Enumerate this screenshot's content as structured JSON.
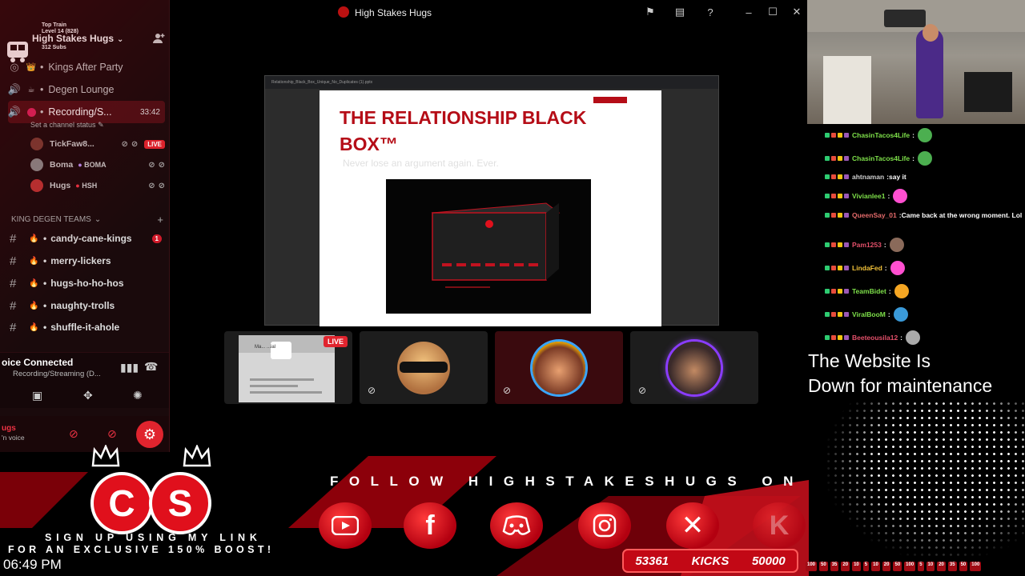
{
  "window": {
    "title": "High Stakes Hugs"
  },
  "sidebar": {
    "server_name": "High Stakes Hugs",
    "train": {
      "title": "Top Train",
      "level": "Level 14  (828)",
      "subs": "312 Subs"
    },
    "channels": [
      {
        "name": "Kings After Party"
      },
      {
        "name": "Degen Lounge"
      },
      {
        "name": "Recording/S...",
        "time": "33:42",
        "status": "Set a channel status"
      }
    ],
    "voice_users": [
      {
        "name": "TickFaw8...",
        "badge": "LIVE"
      },
      {
        "name": "Boma",
        "tag": "BOMA"
      },
      {
        "name": "Hugs",
        "tag": "HSH"
      }
    ],
    "category": "KING DEGEN TEAMS",
    "text_channels": [
      {
        "name": "candy-cane-kings",
        "count": "1"
      },
      {
        "name": "merry-lickers"
      },
      {
        "name": "hugs-ho-ho-hos"
      },
      {
        "name": "naughty-trolls"
      },
      {
        "name": "shuffle-it-ahole"
      }
    ],
    "voice_panel": {
      "title": "oice Connected",
      "subtitle": "Recording/Streaming (D..."
    },
    "user_panel": {
      "name": "ugs",
      "status": "'n voice"
    }
  },
  "screen": {
    "browser_tab": "Relationship_Black_Box_Unique_No_Duplicates (1).pptx",
    "slide": {
      "title": "THE RELATIONSHIP BLACK BOX™",
      "subtitle": "Never lose an argument again. Ever."
    },
    "tiles": [
      {
        "live": "LIVE",
        "preview_label": "Ma... ...ial"
      },
      {},
      {},
      {}
    ]
  },
  "chat": {
    "messages": [
      {
        "user": "ChasinTacos4Life",
        "text": "",
        "color": "#7ee04a"
      },
      {
        "user": "ChasinTacos4Life",
        "text": "",
        "color": "#7ee04a"
      },
      {
        "user": "ahtnaman",
        "text": "say it",
        "color": "#cfcfcf"
      },
      {
        "user": "Vivianlee1",
        "text": "",
        "color": "#7ee04a"
      },
      {
        "user": "QueenSay_01",
        "text": "Came back at the wrong moment. Lol",
        "color": "#e36a6a"
      },
      {
        "user": "Pam1253",
        "text": "",
        "color": "#e3506a"
      },
      {
        "user": "LindaFed",
        "text": "",
        "color": "#f2c23a"
      },
      {
        "user": "TeamBidet",
        "text": "",
        "color": "#7ee04a"
      },
      {
        "user": "ViralBooM",
        "text": "",
        "color": "#7ee04a"
      },
      {
        "user": "Beeteousila12",
        "text": "",
        "color": "#e3506a"
      }
    ],
    "maintenance_line1": "The Website Is",
    "maintenance_line2": "Down for maintenance"
  },
  "overlay": {
    "follow": "FOLLOW HIGHSTAKESHUGS ON",
    "signup_line1": "SIGN UP USING MY LINK",
    "signup_line2": "FOR AN EXCLUSIVE 150% BOOST!",
    "clock": "06:49 PM",
    "kicks_left": "53361",
    "kicks_label": "KICKS",
    "kicks_right": "50000",
    "logo_letters": [
      "C",
      "S"
    ],
    "ticker": [
      "100",
      "50",
      "35",
      "20",
      "10",
      "5",
      "10",
      "20",
      "50",
      "100",
      "5",
      "10",
      "20",
      "35",
      "50",
      "100"
    ]
  },
  "colors": {
    "accent": "#e0242e",
    "slide_red": "#b50d17",
    "sidebar_bg": "#1a0a0c"
  }
}
